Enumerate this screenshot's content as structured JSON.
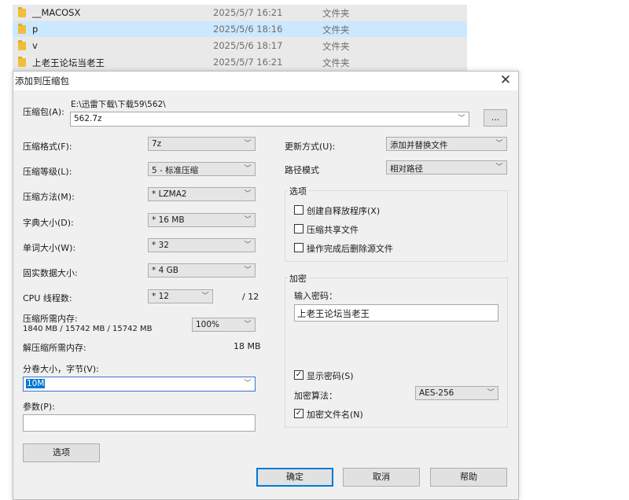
{
  "files": [
    {
      "name": "__MACOSX",
      "date": "2025/5/7 16:21",
      "type": "文件夹",
      "selected": false
    },
    {
      "name": "p",
      "date": "2025/5/6 18:16",
      "type": "文件夹",
      "selected": true
    },
    {
      "name": "v",
      "date": "2025/5/6 18:17",
      "type": "文件夹",
      "selected": false
    },
    {
      "name": "上老王论坛当老王",
      "date": "2025/5/7 16:21",
      "type": "文件夹",
      "selected": false
    }
  ],
  "dialog": {
    "title": "添加到压缩包",
    "close_glyph": "✕",
    "archive": {
      "label": "压缩包(A):",
      "path": "E:\\迅雷下载\\下载59\\562\\",
      "value": "562.7z",
      "browse_label": "..."
    },
    "format": {
      "label": "压缩格式(F):",
      "value": "7z"
    },
    "level": {
      "label": "压缩等级(L):",
      "value": "5 - 标准压缩"
    },
    "method": {
      "label": "压缩方法(M):",
      "value": "* LZMA2"
    },
    "dict": {
      "label": "字典大小(D):",
      "value": "* 16 MB"
    },
    "word": {
      "label": "单词大小(W):",
      "value": "* 32"
    },
    "solid": {
      "label": "固实数据大小:",
      "value": "* 4 GB"
    },
    "threads": {
      "label": "CPU 线程数:",
      "value": "* 12",
      "max": "/ 12"
    },
    "mem_compress": {
      "label": "压缩所需内存:",
      "detail": "1840 MB / 15742 MB / 15742 MB",
      "value": "100%"
    },
    "mem_decompress": {
      "label": "解压缩所需内存:",
      "value": "18 MB"
    },
    "volume": {
      "label": "分卷大小，字节(V):",
      "value": "10M"
    },
    "params": {
      "label": "参数(P):",
      "value": ""
    },
    "options_button": "选项",
    "update_mode": {
      "label": "更新方式(U):",
      "value": "添加并替换文件"
    },
    "path_mode": {
      "label": "路径模式",
      "value": "相对路径"
    },
    "options_group": {
      "label": "选项",
      "items": [
        {
          "label": "创建自释放程序(X)",
          "checked": false
        },
        {
          "label": "压缩共享文件",
          "checked": false
        },
        {
          "label": "操作完成后删除源文件",
          "checked": false
        }
      ]
    },
    "encryption": {
      "label": "加密",
      "password_label": "输入密码：",
      "password_value": "上老王论坛当老王",
      "show_password": {
        "label": "显示密码(S)",
        "checked": true
      },
      "method_label": "加密算法：",
      "method_value": "AES-256",
      "encrypt_names": {
        "label": "加密文件名(N)",
        "checked": true
      }
    },
    "buttons": {
      "ok": "确定",
      "cancel": "取消",
      "help": "帮助"
    }
  },
  "icons": {
    "folder": "folder-icon",
    "dropdown": "chevron-down-icon",
    "close": "close-icon",
    "check": "check-icon"
  },
  "colors": {
    "selection": "#cce8ff",
    "accent": "#0078d7",
    "folder": "#f0bf3a"
  }
}
